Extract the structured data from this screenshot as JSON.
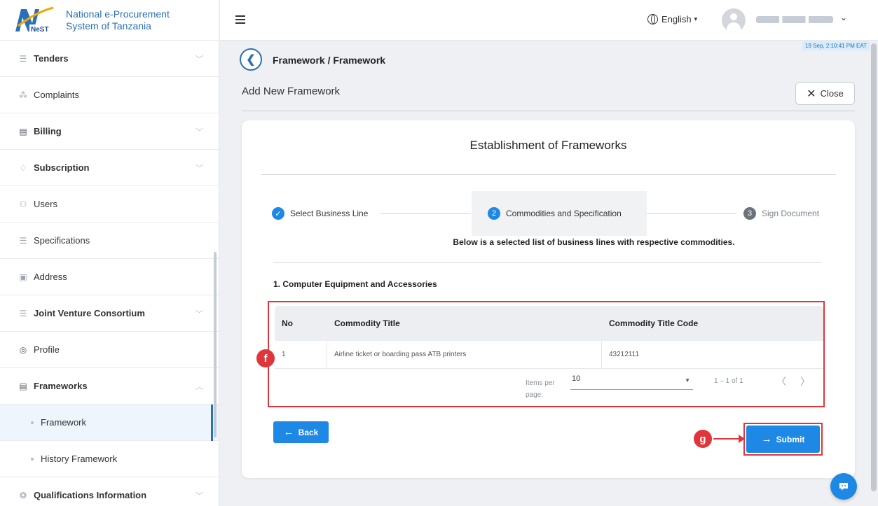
{
  "brand": {
    "line1": "National e-Procurement",
    "line2": "System of Tanzania",
    "logo_text": "NeST"
  },
  "sidebar": {
    "items": [
      {
        "label": "Tenders",
        "icon": "list-icon"
      },
      {
        "label": "Complaints",
        "icon": "complaints-icon"
      },
      {
        "label": "Billing",
        "icon": "billing-icon"
      },
      {
        "label": "Subscription",
        "icon": "bell-icon"
      },
      {
        "label": "Users",
        "icon": "users-icon"
      },
      {
        "label": "Specifications",
        "icon": "list-icon"
      },
      {
        "label": "Address",
        "icon": "clipboard-icon"
      },
      {
        "label": "Joint Venture Consortium",
        "icon": "list-icon"
      },
      {
        "label": "Profile",
        "icon": "profile-icon"
      },
      {
        "label": "Frameworks",
        "icon": "document-icon"
      }
    ],
    "sub_items": [
      {
        "label": "Framework"
      },
      {
        "label": "History Framework"
      }
    ],
    "last_item": {
      "label": "Qualifications Information",
      "icon": "qualifications-icon"
    }
  },
  "topbar": {
    "language": "English",
    "language_caret": "▾",
    "user_caret": "⌄",
    "timestamp": "19 Sep, 2:10:41 PM EAT"
  },
  "header": {
    "breadcrumb": "Framework / Framework",
    "subtitle": "Add New Framework",
    "close_label": "Close"
  },
  "card": {
    "title": "Establishment of Frameworks",
    "steps": [
      {
        "num": "✓",
        "label": "Select Business Line",
        "state": "done"
      },
      {
        "num": "2",
        "label": "Commodities and Specification",
        "state": "active"
      },
      {
        "num": "3",
        "label": "Sign Document",
        "state": "pending"
      }
    ],
    "note": "Below is a selected list of business lines with respective commodities.",
    "section_title": "1. Computer Equipment and Accessories",
    "table": {
      "headers": [
        "No",
        "Commodity Title",
        "Commodity Title Code"
      ],
      "rows": [
        [
          "1",
          "Airline ticket or boarding pass ATB printers",
          "43212111"
        ]
      ]
    },
    "pager": {
      "items_per_page_label": "Items per page:",
      "items_per_page": "10",
      "range": "1 – 1 of 1"
    },
    "back_label": "Back",
    "submit_label": "Submit"
  },
  "markers": {
    "f": "f",
    "g": "g"
  },
  "colors": {
    "primary": "#1e88e5",
    "brand": "#2a70b8",
    "annotation": "#e0353b"
  }
}
